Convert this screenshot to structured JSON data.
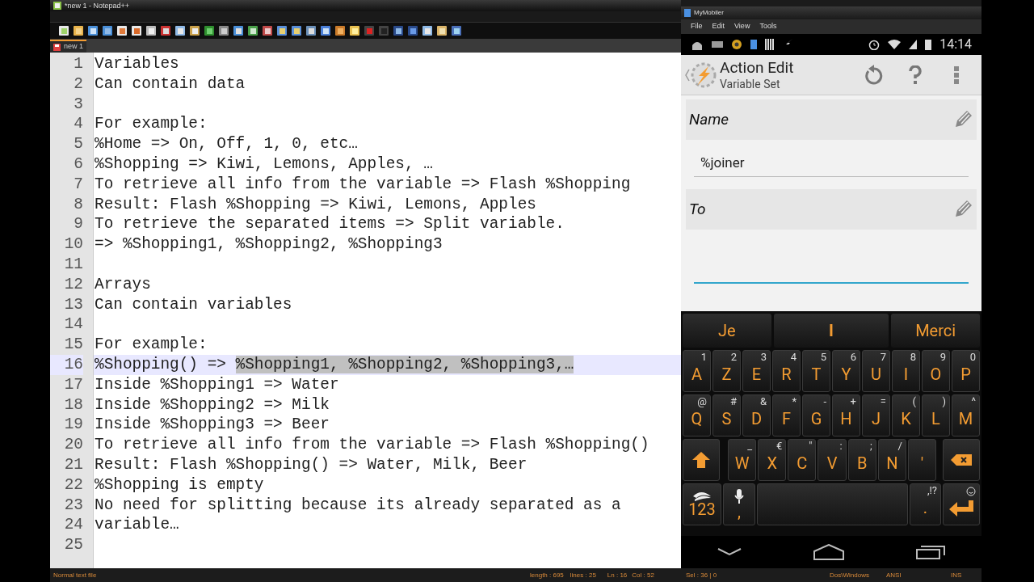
{
  "notepad": {
    "title": "*new  1 - Notepad++",
    "tab": {
      "label": "new  1",
      "selected": true
    },
    "lines": [
      {
        "number": "1",
        "text": "Variables"
      },
      {
        "number": "2",
        "text": "Can contain data"
      },
      {
        "number": "3"
      },
      {
        "number": "4",
        "text": "For example:"
      },
      {
        "number": "5",
        "text": "%Home => On, Off, 1, 0, etc…"
      },
      {
        "number": "6",
        "text": "%Shopping => Kiwi, Lemons, Apples, …"
      },
      {
        "number": "7",
        "text": "To retrieve all info from the variable => Flash %Shopping"
      },
      {
        "number": "8",
        "text": "Result: Flash %Shopping => Kiwi, Lemons, Apples"
      },
      {
        "number": "9",
        "text": "To retrieve the separated items => Split variable."
      },
      {
        "number": "10",
        "text": "=> %Shopping1, %Shopping2, %Shopping3"
      },
      {
        "number": "11"
      },
      {
        "number": "12",
        "text": "Arrays"
      },
      {
        "number": "13",
        "text": "Can contain variables"
      },
      {
        "number": "14"
      },
      {
        "number": "15",
        "text": "For example:"
      },
      {
        "number": "16",
        "text": "%Shopping() => ",
        "selection": "%Shopping1, %Shopping2, %Shopping3,…",
        "current": true
      },
      {
        "number": "17",
        "text": "Inside %Shopping1 => Water"
      },
      {
        "number": "18",
        "text": "Inside %Shopping2 => Milk"
      },
      {
        "number": "19",
        "text": "Inside %Shopping3 => Beer"
      },
      {
        "number": "20",
        "text": "To retrieve all info from the variable => Flash %Shopping()"
      },
      {
        "number": "21",
        "text": "Result: Flash %Shopping() => Water, Milk, Beer"
      },
      {
        "number": "22",
        "text": "%Shopping is empty"
      },
      {
        "number": "23",
        "text": "No need for splitting because its already separated as a"
      },
      {
        "number": "24",
        "text": "variable…"
      },
      {
        "number": "25"
      }
    ],
    "status_bar": {
      "file_type": "Normal text file",
      "length": "length : 695",
      "lines": "lines : 25",
      "ln": "Ln : 16",
      "col": "Col : 52",
      "sel": "Sel : 36 | 0",
      "eol": "Dos\\Windows",
      "encoding": "ANSI",
      "mode": "INS"
    }
  },
  "mymobiler": {
    "title": "MyMobiler",
    "menu": [
      "File",
      "Edit",
      "View",
      "Tools"
    ],
    "time": "14:14",
    "action_bar": {
      "title": "Action Edit",
      "subtitle": "Variable Set"
    },
    "fields": [
      {
        "label": "Name",
        "value": "%joiner",
        "focused": false
      },
      {
        "label": "To",
        "focused": true
      }
    ],
    "suggestions": [
      {
        "text": "Je",
        "selected": false
      },
      {
        "text": "I",
        "selected": true
      },
      {
        "text": "Merci",
        "selected": false
      }
    ],
    "keyboard": [
      [
        {
          "kind": "key",
          "main": "A",
          "sub": "1"
        },
        {
          "kind": "key",
          "main": "Z",
          "sub": "2"
        },
        {
          "kind": "key",
          "main": "E",
          "sub": "3"
        },
        {
          "kind": "key",
          "main": "R",
          "sub": "4"
        },
        {
          "kind": "key",
          "main": "T",
          "sub": "5"
        },
        {
          "kind": "key",
          "main": "Y",
          "sub": "6"
        },
        {
          "kind": "key",
          "main": "U",
          "sub": "7"
        },
        {
          "kind": "key",
          "main": "I",
          "sub": "8"
        },
        {
          "kind": "key",
          "main": "O",
          "sub": "9"
        },
        {
          "kind": "key",
          "main": "P",
          "sub": "0"
        }
      ],
      [
        {
          "kind": "key",
          "main": "Q",
          "sub": "@"
        },
        {
          "kind": "key",
          "main": "S",
          "sub": "#"
        },
        {
          "kind": "key",
          "main": "D",
          "sub": "&"
        },
        {
          "kind": "key",
          "main": "F",
          "sub": "*"
        },
        {
          "kind": "key",
          "main": "G",
          "sub": "-"
        },
        {
          "kind": "key",
          "main": "H",
          "sub": "+"
        },
        {
          "kind": "key",
          "main": "J",
          "sub": "="
        },
        {
          "kind": "key",
          "main": "K",
          "sub": "("
        },
        {
          "kind": "key",
          "main": "L",
          "sub": ")"
        },
        {
          "kind": "key",
          "main": "M",
          "sub": "^"
        }
      ],
      [
        {
          "kind": "shift"
        },
        {
          "kind": "key",
          "main": "W",
          "sub": "_"
        },
        {
          "kind": "key",
          "main": "X",
          "sub": "€"
        },
        {
          "kind": "key",
          "main": "C",
          "sub": "\""
        },
        {
          "kind": "key",
          "main": "V",
          "sub": ":"
        },
        {
          "kind": "key",
          "main": "B",
          "sub": ";"
        },
        {
          "kind": "key",
          "main": "N",
          "sub": "/"
        },
        {
          "kind": "key",
          "main": "'"
        },
        {
          "kind": "backspace"
        }
      ],
      [
        {
          "kind": "mode",
          "main": "123"
        },
        {
          "kind": "mic",
          "main": ","
        },
        {
          "kind": "space"
        },
        {
          "kind": "key",
          "main": ".",
          "sub": ",!?"
        },
        {
          "kind": "enter"
        }
      ]
    ]
  }
}
